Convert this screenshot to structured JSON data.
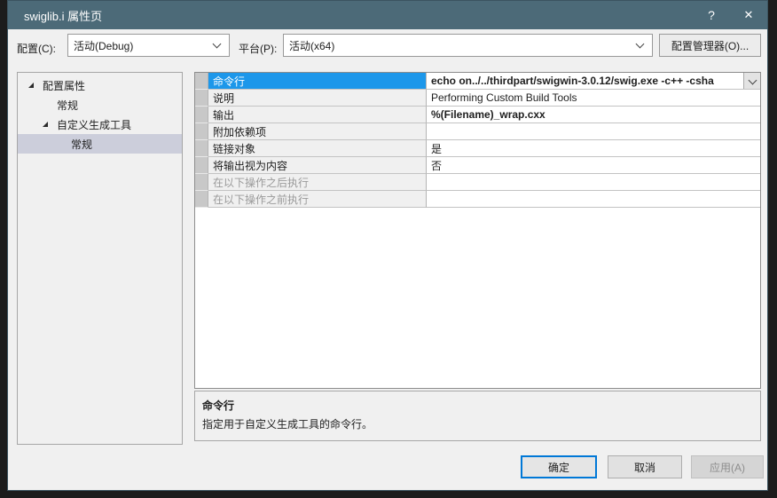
{
  "window": {
    "title": "swiglib.i 属性页",
    "help_glyph": "?",
    "close_glyph": "✕"
  },
  "config_bar": {
    "config_label": "配置(C):",
    "config_value": "活动(Debug)",
    "platform_label": "平台(P):",
    "platform_value": "活动(x64)",
    "manager_button": "配置管理器(O)..."
  },
  "tree": {
    "items": [
      {
        "label": "配置属性",
        "level": 0,
        "expanded": true,
        "selected": false
      },
      {
        "label": "常规",
        "level": 1,
        "expanded": false,
        "selected": false
      },
      {
        "label": "自定义生成工具",
        "level": 1,
        "expanded": true,
        "selected": false
      },
      {
        "label": "常规",
        "level": 2,
        "expanded": false,
        "selected": true
      }
    ]
  },
  "property_grid": {
    "rows": [
      {
        "name": "命令行",
        "value": "echo on../../thirdpart/swigwin-3.0.12/swig.exe -c++ -csha",
        "selected": true,
        "bold": true,
        "has_dropdown": true,
        "disabled": false
      },
      {
        "name": "说明",
        "value": "Performing Custom Build Tools",
        "selected": false,
        "bold": false,
        "has_dropdown": false,
        "disabled": false
      },
      {
        "name": "输出",
        "value": "%(Filename)_wrap.cxx",
        "selected": false,
        "bold": true,
        "has_dropdown": false,
        "disabled": false
      },
      {
        "name": "附加依赖项",
        "value": "",
        "selected": false,
        "bold": false,
        "has_dropdown": false,
        "disabled": false
      },
      {
        "name": "链接对象",
        "value": "是",
        "selected": false,
        "bold": false,
        "has_dropdown": false,
        "disabled": false
      },
      {
        "name": "将输出视为内容",
        "value": "否",
        "selected": false,
        "bold": false,
        "has_dropdown": false,
        "disabled": false
      },
      {
        "name": "在以下操作之后执行",
        "value": "",
        "selected": false,
        "bold": false,
        "has_dropdown": false,
        "disabled": true
      },
      {
        "name": "在以下操作之前执行",
        "value": "",
        "selected": false,
        "bold": false,
        "has_dropdown": false,
        "disabled": true
      }
    ]
  },
  "description": {
    "title": "命令行",
    "text": "指定用于自定义生成工具的命令行。"
  },
  "footer": {
    "ok_label": "确定",
    "cancel_label": "取消",
    "apply_label": "应用(A)"
  },
  "colors": {
    "titlebar": "#4c6a78",
    "selection_blue": "#1c97ea",
    "tree_selection": "#cccedb",
    "focus_border": "#0078d7",
    "dark_surround": "#1c1c1c"
  }
}
